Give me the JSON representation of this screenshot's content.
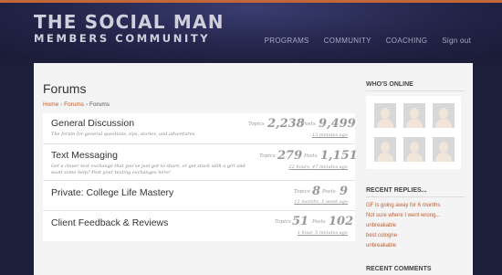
{
  "brand": {
    "line1": "THE SOCIAL MAN",
    "line2": "MEMBERS COMMUNITY"
  },
  "nav": {
    "programs": "PROGRAMS",
    "community": "COMMUNITY",
    "coaching": "COACHING",
    "signout": "Sign out"
  },
  "main": {
    "title": "Forums",
    "breadcrumb": {
      "home": "Home",
      "forums": "Forums",
      "current": "Forums",
      "separator": "›"
    },
    "forums": [
      {
        "name": "General Discussion",
        "description": "The forum for general questions, tips, stories, and adventures.",
        "topics_label": "Topics",
        "topics": "2,238",
        "posts_label": "Posts",
        "posts": "9,499",
        "last_post": "13 minutes ago"
      },
      {
        "name": "Text Messaging",
        "description": "Get a clever text exchange that you've just got to share, or get stuck with a girl and want some help? Post your texting exchanges here!",
        "topics_label": "Topics",
        "topics": "279",
        "posts_label": "Posts",
        "posts": "1,151",
        "last_post": "22 hours, 47 minutes ago"
      },
      {
        "name": "Private: College Life Mastery",
        "description": "",
        "topics_label": "Topics",
        "topics": "8",
        "posts_label": "Posts",
        "posts": "9",
        "last_post": "11 months, 1 week ago"
      },
      {
        "name": "Client Feedback & Reviews",
        "description": "",
        "topics_label": "Topics",
        "topics": "51",
        "posts_label": "Posts",
        "posts": "102",
        "last_post": "1 hour, 5 minutes ago"
      }
    ]
  },
  "sidebar": {
    "whos_online": "WHO'S ONLINE",
    "recent_replies": "RECENT REPLIES...",
    "replies": [
      "GF is going away for 6 months",
      "Not sure where I went wrong...",
      "unbreakable",
      "best cologne",
      "unbreakable"
    ],
    "recent_comments": "RECENT COMMENTS"
  },
  "colors": {
    "accent": "#c25b2b",
    "header_bg": "#23254a",
    "page_bg": "#f4f4f4"
  }
}
